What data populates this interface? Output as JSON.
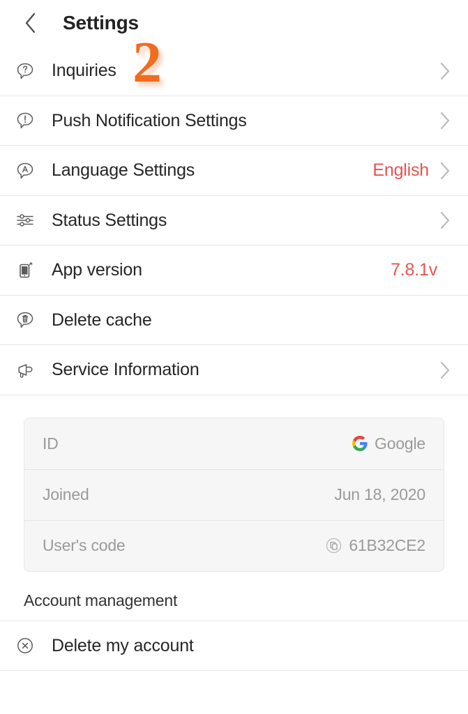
{
  "header": {
    "back_icon": "chevron-left-icon",
    "title": "Settings"
  },
  "annotation": {
    "label": "2",
    "color": "#F26B1F"
  },
  "colors": {
    "accent_red": "#E8534F",
    "annotation_orange": "#F26B1F",
    "card_bg": "#f6f6f6",
    "divider": "#e6e6e6",
    "muted_text": "#9a9a9a"
  },
  "settings_rows": [
    {
      "icon": "question-bubble-icon",
      "label": "Inquiries",
      "value": "",
      "chevron": true
    },
    {
      "icon": "exclamation-bubble-icon",
      "label": "Push Notification Settings",
      "value": "",
      "chevron": true
    },
    {
      "icon": "language-bubble-icon",
      "label": "Language Settings",
      "value": "English",
      "chevron": true
    },
    {
      "icon": "sliders-icon",
      "label": "Status Settings",
      "value": "",
      "chevron": true
    },
    {
      "icon": "phone-icon",
      "label": "App version",
      "value": "7.8.1v",
      "chevron": false
    },
    {
      "icon": "trash-bubble-icon",
      "label": "Delete cache",
      "value": "",
      "chevron": false
    },
    {
      "icon": "megaphone-icon",
      "label": "Service Information",
      "value": "",
      "chevron": true
    }
  ],
  "info_card": {
    "rows": [
      {
        "key": "ID",
        "value": "Google",
        "icon": "google-logo-icon"
      },
      {
        "key": "Joined",
        "value": "Jun 18, 2020",
        "icon": ""
      },
      {
        "key": "User's code",
        "value": "61B32CE2",
        "icon": "copy-icon"
      }
    ]
  },
  "account_section": {
    "heading": "Account management",
    "items": [
      {
        "icon": "circle-x-icon",
        "label": "Delete my account"
      }
    ]
  }
}
